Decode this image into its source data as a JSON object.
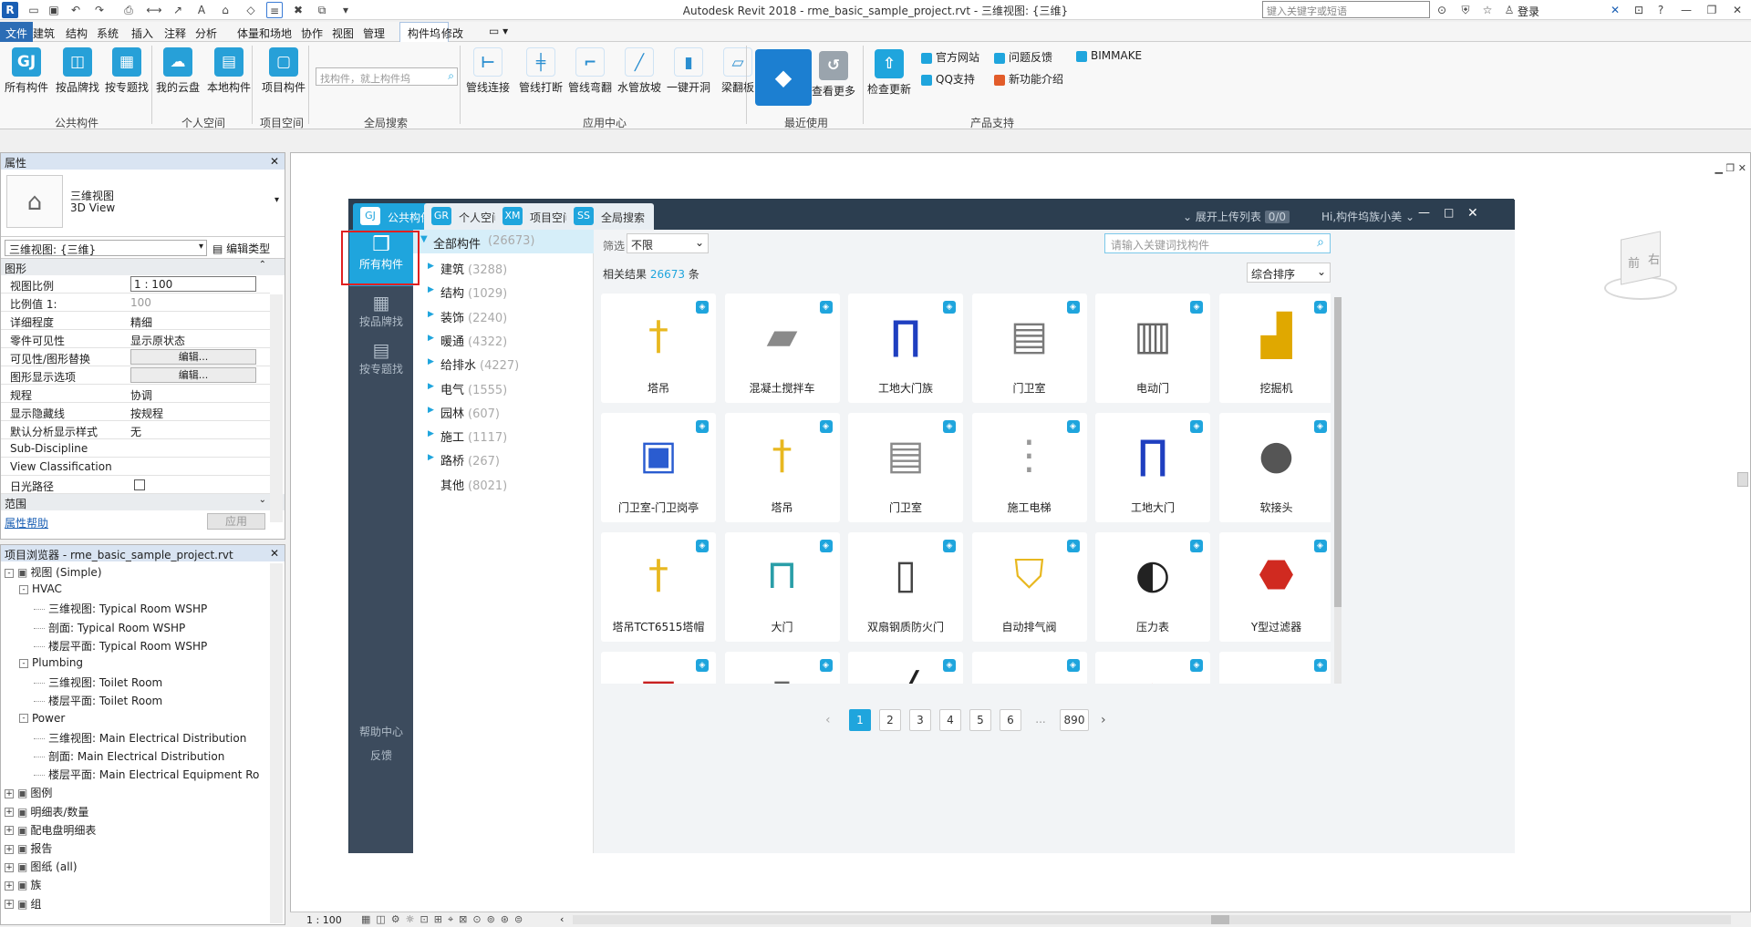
{
  "titlebar": {
    "app_title": "Autodesk Revit 2018 -    rme_basic_sample_project.rvt - 三维视图: {三维}",
    "search_placeholder": "键入关键字或短语",
    "login": "登录"
  },
  "menu": {
    "items": [
      "文件",
      "建筑",
      "结构",
      "系统",
      "插入",
      "注释",
      "分析",
      "体量和场地",
      "协作",
      "视图",
      "管理",
      "构件坞",
      "修改"
    ],
    "active_index": 11
  },
  "ribbon": {
    "buttons": [
      "所有构件",
      "按品牌找",
      "按专题找",
      "我的云盘",
      "本地构件",
      "项目构件"
    ],
    "search_placeholder": "找构件，就上构件坞",
    "apps": [
      "管线连接",
      "管线打断",
      "管线弯翻",
      "水管放坡",
      "一键开洞",
      "梁翻板"
    ],
    "see_more": "查看更多",
    "check_update": "检查更新",
    "links": [
      "官方网站",
      "问题反馈",
      "BIMMAKE",
      "QQ支持",
      "新功能介绍"
    ],
    "panels": [
      "公共构件",
      "个人空间",
      "项目空间",
      "全局搜索",
      "应用中心",
      "最近使用",
      "产品支持"
    ]
  },
  "properties": {
    "title": "属性",
    "type_name": "三维视图",
    "type_sub": "3D View",
    "selector": "三维视图: {三维}",
    "edit_type": "编辑类型",
    "group_graphics": "图形",
    "rows": [
      {
        "k": "视图比例",
        "v": "1 : 100",
        "kind": "input"
      },
      {
        "k": "比例值 1:",
        "v": "100",
        "kind": "grey"
      },
      {
        "k": "详细程度",
        "v": "精细",
        "kind": "text"
      },
      {
        "k": "零件可见性",
        "v": "显示原状态",
        "kind": "text"
      },
      {
        "k": "可见性/图形替换",
        "v": "编辑...",
        "kind": "btn"
      },
      {
        "k": "图形显示选项",
        "v": "编辑...",
        "kind": "btn"
      },
      {
        "k": "规程",
        "v": "协调",
        "kind": "text"
      },
      {
        "k": "显示隐藏线",
        "v": "按规程",
        "kind": "text"
      },
      {
        "k": "默认分析显示样式",
        "v": "无",
        "kind": "text"
      },
      {
        "k": "Sub-Discipline",
        "v": "",
        "kind": "text"
      },
      {
        "k": "View Classification",
        "v": "",
        "kind": "text"
      },
      {
        "k": "日光路径",
        "v": "",
        "kind": "check"
      }
    ],
    "group_range": "范围",
    "help": "属性帮助",
    "apply": "应用"
  },
  "browser": {
    "title": "项目浏览器 - rme_basic_sample_project.rvt",
    "nodes": [
      {
        "t": "视图 (Simple)",
        "lvl": 0,
        "box": "-"
      },
      {
        "t": "HVAC",
        "lvl": 1,
        "box": "-"
      },
      {
        "t": "三维视图: Typical Room WSHP",
        "lvl": 2
      },
      {
        "t": "剖面: Typical Room WSHP",
        "lvl": 2
      },
      {
        "t": "楼层平面: Typical Room WSHP",
        "lvl": 2
      },
      {
        "t": "Plumbing",
        "lvl": 1,
        "box": "-"
      },
      {
        "t": "三维视图: Toilet Room",
        "lvl": 2
      },
      {
        "t": "楼层平面: Toilet Room",
        "lvl": 2
      },
      {
        "t": "Power",
        "lvl": 1,
        "box": "-"
      },
      {
        "t": "三维视图: Main Electrical Distribution",
        "lvl": 2
      },
      {
        "t": "剖面: Main Electrical Distribution",
        "lvl": 2
      },
      {
        "t": "楼层平面: Main Electrical Equipment Ro",
        "lvl": 2
      },
      {
        "t": "图例",
        "lvl": 0,
        "box": "+"
      },
      {
        "t": "明细表/数量",
        "lvl": 0,
        "box": "+"
      },
      {
        "t": "配电盘明细表",
        "lvl": 0,
        "box": "+"
      },
      {
        "t": "报告",
        "lvl": 0,
        "box": "+"
      },
      {
        "t": "图纸 (all)",
        "lvl": 0,
        "box": "+"
      },
      {
        "t": "族",
        "lvl": 0,
        "box": "+"
      },
      {
        "t": "组",
        "lvl": 0,
        "box": "+"
      }
    ]
  },
  "status": {
    "scale": "1 : 100"
  },
  "viewcube": {
    "face": "前",
    "right": "右"
  },
  "dialog": {
    "tabs": [
      "公共构件",
      "个人空间",
      "项目空间",
      "全局搜索"
    ],
    "tab_icons": [
      "GJ",
      "GR",
      "XM",
      "SS"
    ],
    "upload_list": "展开上传列表",
    "upload_count": "0/0",
    "greeting": "Hi,构件坞族小美",
    "side": [
      "所有构件",
      "按品牌找",
      "按专题找"
    ],
    "side_bottom": [
      "帮助中心",
      "反馈"
    ],
    "tree_root": "全部构件",
    "tree_root_count": "(26673)",
    "categories": [
      {
        "n": "建筑",
        "c": "(3288)"
      },
      {
        "n": "结构",
        "c": "(1029)"
      },
      {
        "n": "装饰",
        "c": "(2240)"
      },
      {
        "n": "暖通",
        "c": "(4322)"
      },
      {
        "n": "给排水",
        "c": "(4227)"
      },
      {
        "n": "电气",
        "c": "(1555)"
      },
      {
        "n": "园林",
        "c": "(607)"
      },
      {
        "n": "施工",
        "c": "(1117)"
      },
      {
        "n": "路桥",
        "c": "(267)"
      },
      {
        "n": "其他",
        "c": "(8021)"
      }
    ],
    "filter_label": "筛选",
    "filter_value": "不限",
    "search_placeholder": "请输入关键词找构件",
    "result_prefix": "相关结果",
    "result_count": "26673",
    "result_suffix": "条",
    "sort": "综合排序",
    "cards": [
      "塔吊",
      "混凝土搅拌车",
      "工地大门族",
      "门卫室",
      "电动门",
      "挖掘机",
      "门卫室-门卫岗亭",
      "塔吊",
      "门卫室",
      "施工电梯",
      "工地大门",
      "软接头",
      "塔吊TCT6515塔帽",
      "大门",
      "双扇钢质防火门",
      "自动排气阀",
      "压力表",
      "Y型过滤器",
      "",
      "",
      "",
      "",
      "",
      ""
    ],
    "pages": [
      "1",
      "2",
      "3",
      "4",
      "5",
      "6",
      "...",
      "890"
    ],
    "prev": "‹",
    "next": "›"
  }
}
